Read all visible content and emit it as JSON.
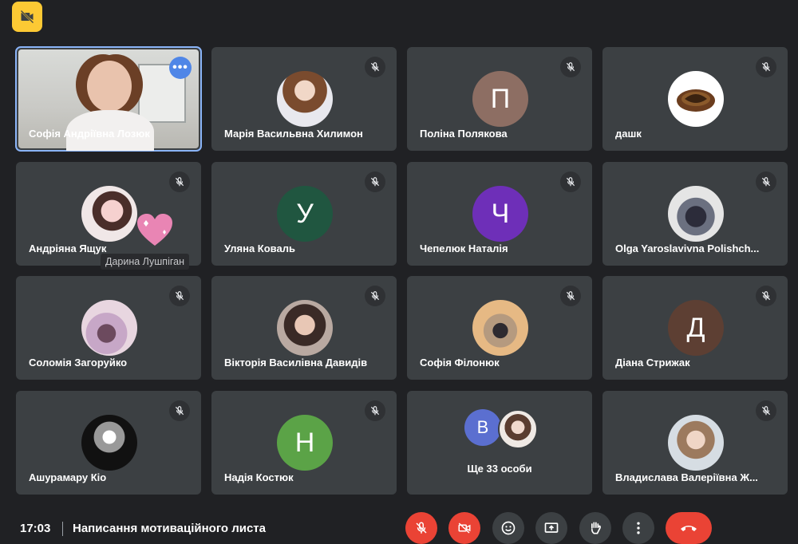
{
  "meeting": {
    "time": "17:03",
    "title": "Написання мотиваційного листа"
  },
  "colors": {
    "background": "#202124",
    "tile": "#3c4043",
    "active_outline": "#8ab4f8",
    "hangup_red": "#ea4335",
    "badge_yellow": "#fcc934"
  },
  "top_badge": {
    "icon": "camera-off-icon"
  },
  "participants": [
    {
      "name": "Софія Андріївна Лозюк",
      "video": true,
      "active": true
    },
    {
      "name": "Марія Васильвна Хилимон",
      "muted": true
    },
    {
      "name": "Поліна Полякова",
      "muted": true,
      "initial": "П",
      "avatar_color": "#8d6e63"
    },
    {
      "name": "дашк",
      "muted": true
    },
    {
      "name": "Андріяна Ящук",
      "muted": true
    },
    {
      "name": "Уляна Коваль",
      "muted": true,
      "initial": "У",
      "avatar_color": "#205640"
    },
    {
      "name": "Чепелюк Наталія",
      "muted": true,
      "initial": "Ч",
      "avatar_color": "#6e2fb8"
    },
    {
      "name": "Olga Yaroslavivna Polishch...",
      "muted": true
    },
    {
      "name": "Соломія Загоруйко",
      "muted": true
    },
    {
      "name": "Вікторія Василівна Давидів",
      "muted": true
    },
    {
      "name": "Софія Філонюк",
      "muted": true
    },
    {
      "name": "Діана Стрижак",
      "muted": true,
      "initial": "Д",
      "avatar_color": "#5d3f33"
    },
    {
      "name": "Ашурамару Кіо",
      "muted": true
    },
    {
      "name": "Надія Костюк",
      "muted": true,
      "initial": "Н",
      "avatar_color": "#5ba347"
    },
    {
      "name": "Владислава Валеріївна Ж...",
      "muted": true
    }
  ],
  "floating_label": "Дарина Лушпіган",
  "overflow": {
    "initial": "В",
    "label": "Ще 33 особи"
  },
  "controls": [
    {
      "name": "mic",
      "icon": "mic-off-icon"
    },
    {
      "name": "camera",
      "icon": "camera-off-icon"
    },
    {
      "name": "emoji",
      "icon": "emoji-icon"
    },
    {
      "name": "present",
      "icon": "present-screen-icon"
    },
    {
      "name": "raise-hand",
      "icon": "hand-icon"
    },
    {
      "name": "more",
      "icon": "more-vert-icon"
    },
    {
      "name": "hang-up",
      "icon": "phone-hangup-icon"
    }
  ]
}
